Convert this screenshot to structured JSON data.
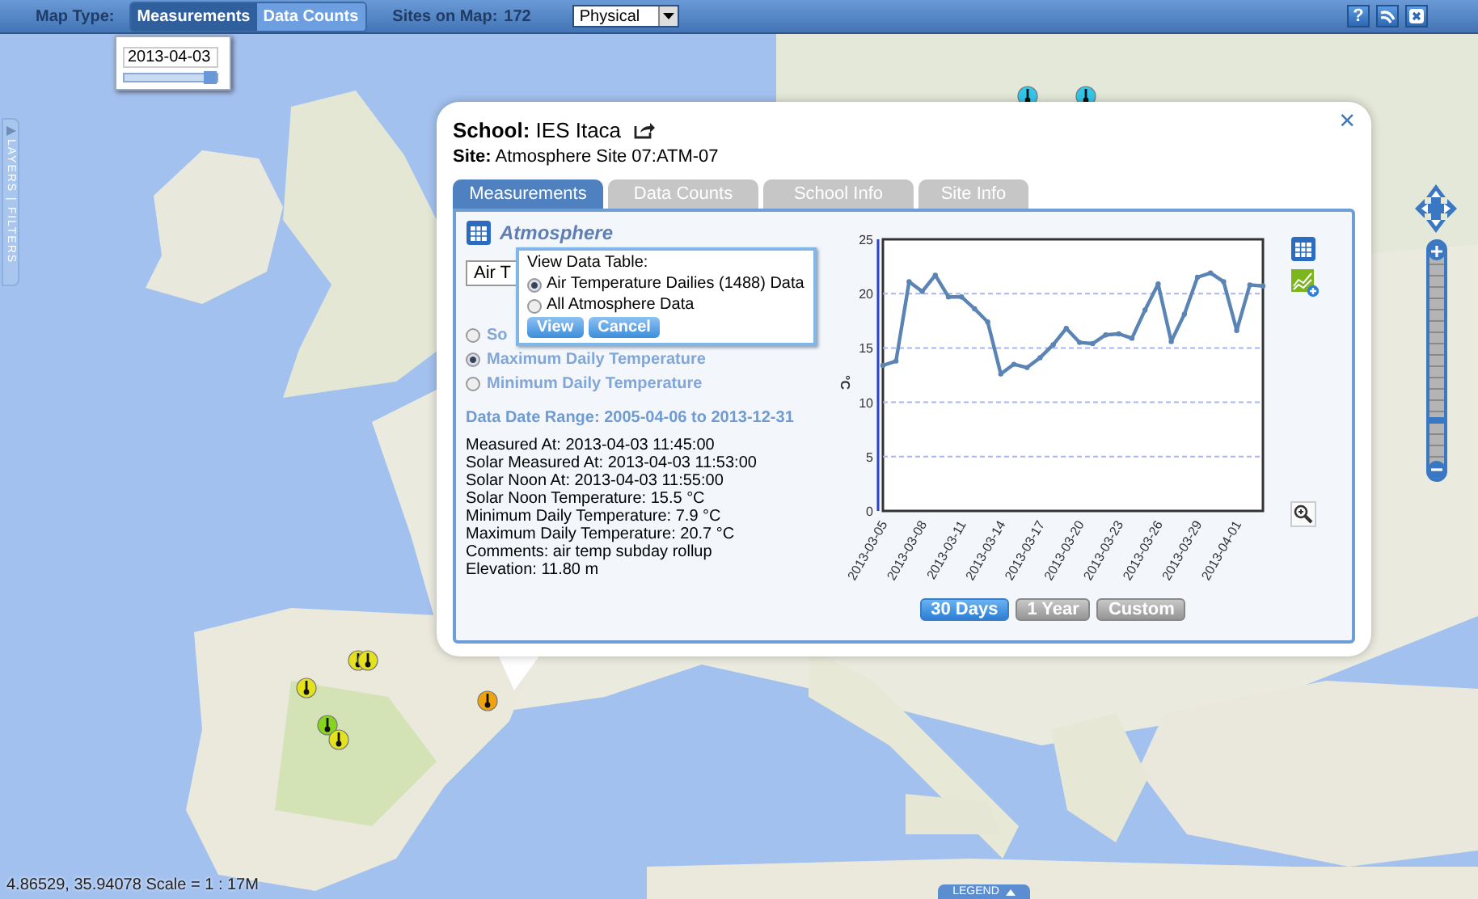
{
  "toolbar": {
    "map_type_label": "Map Type:",
    "map_types": [
      {
        "label": "Measurements",
        "selected": true
      },
      {
        "label": "Data Counts",
        "selected": false
      }
    ],
    "sites_label": "Sites on Map:",
    "sites_count": "172",
    "base_layer": "Physical",
    "help": "?"
  },
  "date_filter": {
    "value": "2013-04-03",
    "level": 1
  },
  "side_tab": "LAYERS | FILTERS",
  "markers": [
    {
      "color": "#e4e21c"
    },
    {
      "color": "#e4e21c"
    },
    {
      "color": "#e4e21c"
    },
    {
      "color": "#86d41e"
    },
    {
      "color": "#e4e21c"
    },
    {
      "color": "#f0a30a"
    },
    {
      "color": "#34c6ea"
    },
    {
      "color": "#34c6ea"
    }
  ],
  "popup": {
    "school": "**School:** IES Itaca",
    "site": "**Site:** Atmosphere Site 07:ATM-07",
    "close": "×",
    "tabs": [
      {
        "label": "Measurements",
        "selected": true
      },
      {
        "label": "Data Counts",
        "selected": false
      },
      {
        "label": "School Info",
        "selected": false
      },
      {
        "label": "Site Info",
        "selected": false
      }
    ],
    "category": "Atmosphere",
    "dataset": "Air T",
    "variables": [
      {
        "label": "So",
        "selected": false
      },
      {
        "label": "Maximum Daily Temperature",
        "selected": true
      },
      {
        "label": "Minimum Daily Temperature",
        "selected": false
      }
    ],
    "date_range": "Data Date Range: 2005-04-06 to 2013-12-31",
    "details": [
      "Measured At: 2013-04-03 11:45:00",
      "Solar Measured At: 2013-04-03 11:53:00",
      "Solar Noon At: 2013-04-03 11:55:00",
      "Solar Noon Temperature: 15.5 °C",
      "Minimum Daily Temperature: 7.9 °C",
      "Maximum Daily Temperature: 20.7 °C",
      "Comments: air temp subday rollup",
      "Elevation: 11.80 m"
    ],
    "data_table_menu": {
      "title": "View Data Table:",
      "options": [
        {
          "label": "Air Temperature Dailies (1488) Data",
          "selected": true
        },
        {
          "label": "All Atmosphere Data",
          "selected": false
        }
      ],
      "buttons": [
        "View",
        "Cancel"
      ]
    },
    "chart_data": {
      "type": "line",
      "ylabel": "°C",
      "ylim": [
        0,
        25
      ],
      "yticks": [
        0,
        5,
        10,
        15,
        20,
        25
      ],
      "grid": true,
      "categories": [
        "2013-03-05",
        null,
        null,
        "2013-03-08",
        null,
        null,
        "2013-03-11",
        null,
        null,
        "2013-03-14",
        null,
        null,
        "2013-03-17",
        null,
        null,
        "2013-03-20",
        null,
        null,
        "2013-03-23",
        null,
        null,
        "2013-03-26",
        null,
        null,
        "2013-03-29",
        null,
        null,
        "2013-04-01",
        null,
        null
      ],
      "series": [
        {
          "color": "#5a84b4",
          "marker": true,
          "values": [
            13.4,
            13.8,
            21.1,
            20.2,
            21.7,
            19.7,
            19.7,
            18.6,
            17.4,
            12.6,
            13.5,
            13.2,
            14.1,
            15.3,
            16.8,
            15.5,
            15.4,
            16.2,
            16.3,
            15.9,
            18.5,
            20.9,
            15.6,
            18.1,
            21.5,
            21.9,
            21.1,
            16.6,
            20.8,
            20.7
          ]
        }
      ]
    },
    "ranges": [
      {
        "label": "30 Days",
        "selected": true
      },
      {
        "label": "1 Year",
        "selected": false
      },
      {
        "label": "Custom",
        "selected": false
      }
    ]
  },
  "zoom": {
    "level": 0.2
  },
  "status": "4.86529, 35.94078 Scale = 1 : 17M",
  "legend": "LEGEND"
}
